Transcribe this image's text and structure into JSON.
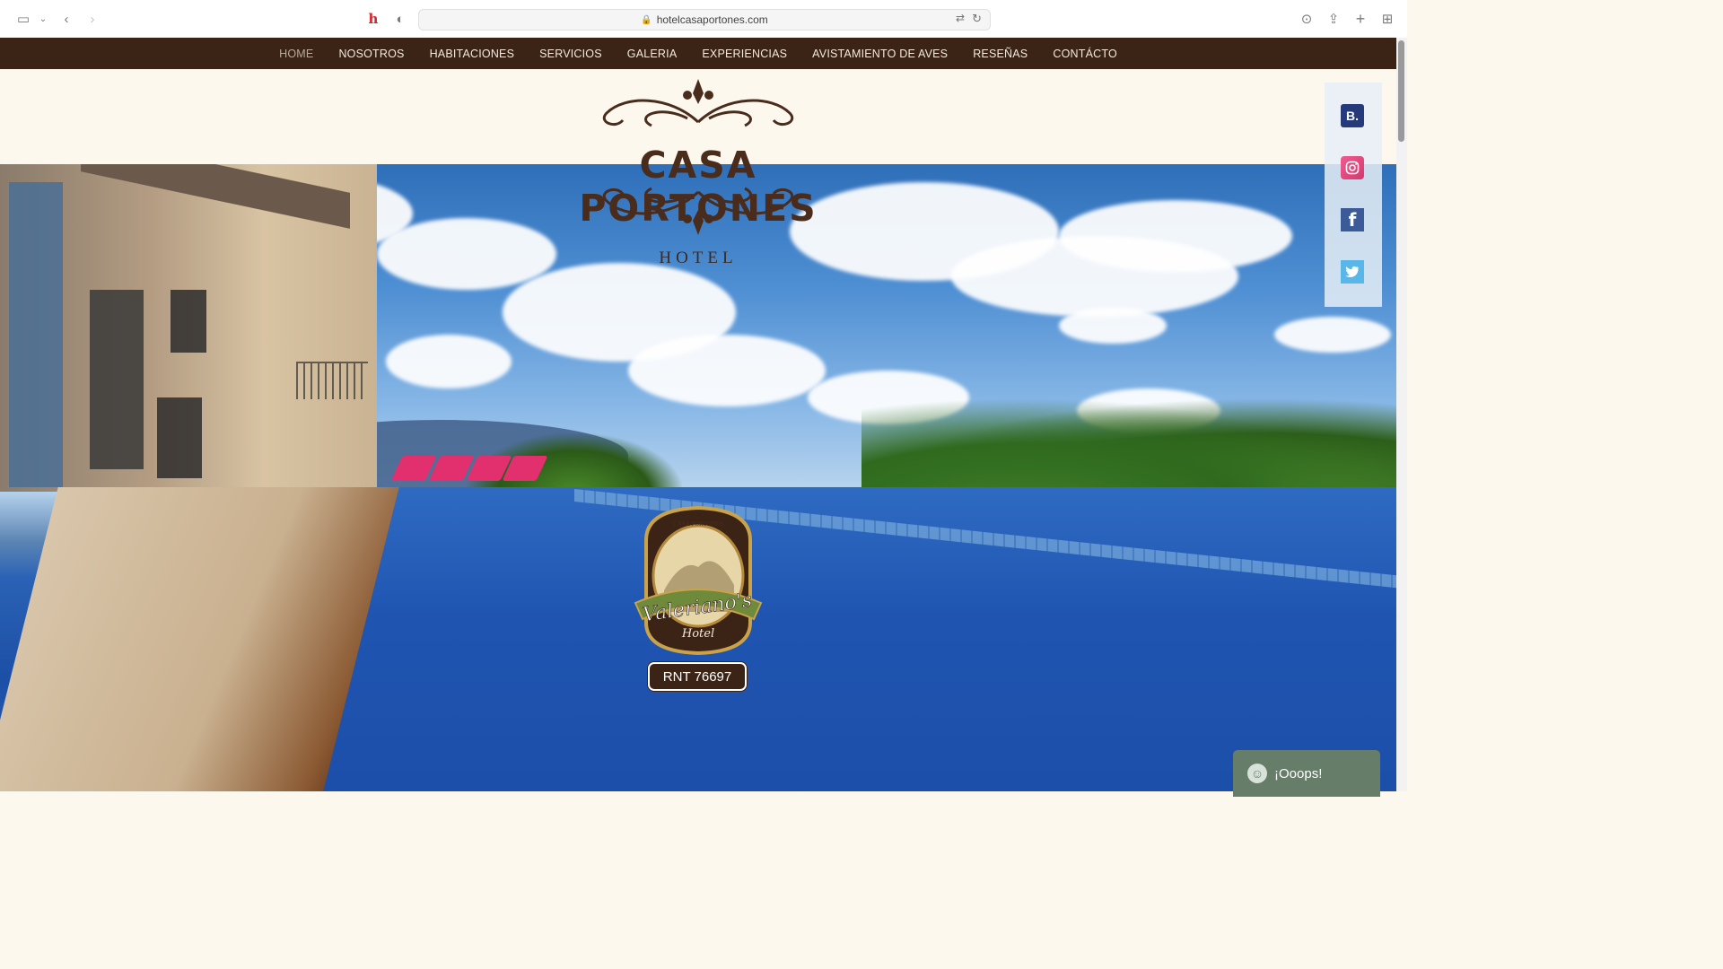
{
  "browser": {
    "url": "hotelcasaportones.com"
  },
  "nav": {
    "items": [
      "HOME",
      "NOSOTROS",
      "HABITACIONES",
      "SERVICIOS",
      "GALERIA",
      "EXPERIENCIAS",
      "AVISTAMIENTO DE AVES",
      "RESEÑAS",
      "CONTÁCTO"
    ],
    "active": "HOME"
  },
  "logo": {
    "title": "CASA PORTONES",
    "subtitle": "HOTEL"
  },
  "badge": {
    "top_text": "CASA PORTONES",
    "name": "Valeriano's",
    "hotel": "Hotel"
  },
  "rnt": "RNT 76697",
  "social": {
    "booking_label": "B.",
    "facebook_label": "f",
    "icons": [
      "booking-icon",
      "instagram-icon",
      "facebook-icon",
      "twitter-icon"
    ]
  },
  "chat_widget": {
    "label": "¡Ooops!"
  },
  "colors": {
    "nav_bg": "#3b2416",
    "header_bg": "#fdf8ee",
    "brand_brown": "#4a2c1c",
    "widget_green": "#657d69"
  }
}
